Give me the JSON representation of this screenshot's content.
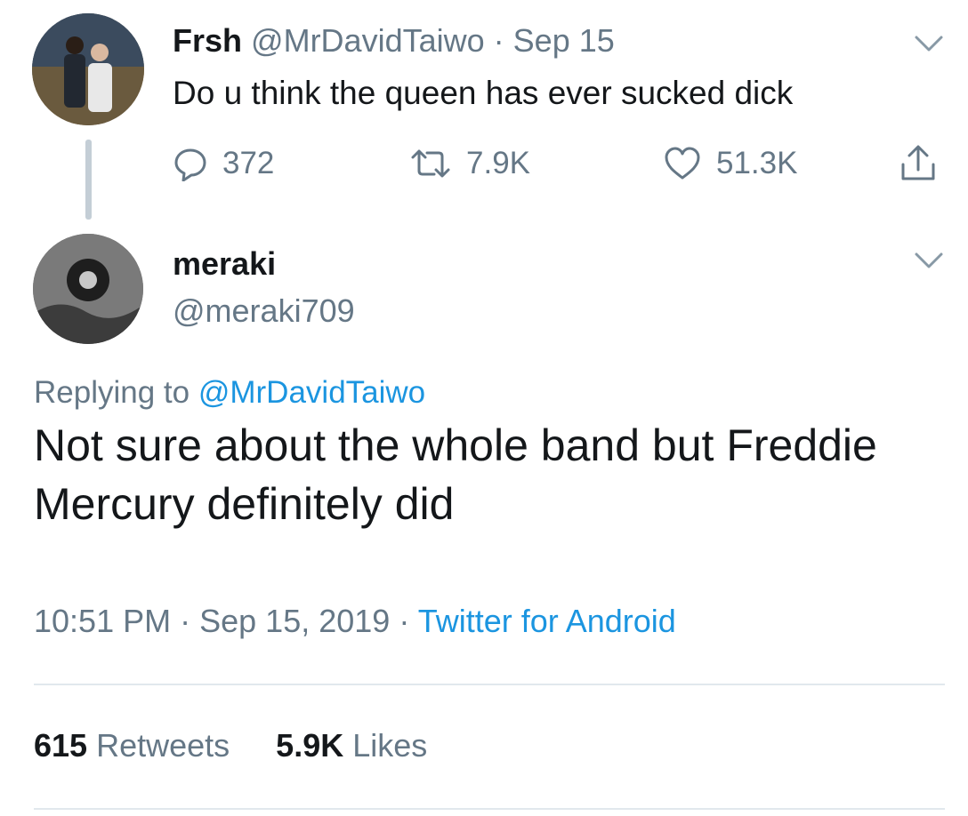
{
  "parent_tweet": {
    "display_name": "Frsh",
    "handle": "@MrDavidTaiwo",
    "separator": "·",
    "date": "Sep 15",
    "text": "Do u think the queen has ever sucked dick",
    "replies": "372",
    "retweets": "7.9K",
    "likes": "51.3K",
    "icons": {
      "reply": "reply-icon",
      "retweet": "retweet-icon",
      "like": "heart-icon",
      "share": "share-icon",
      "menu": "chevron-down-icon"
    }
  },
  "reply_tweet": {
    "display_name": "meraki",
    "handle": "@meraki709",
    "replying_prefix": "Replying to",
    "replying_to": "@MrDavidTaiwo",
    "text": "Not sure about the whole band but Freddie Mercury definitely did",
    "time": "10:51 PM",
    "date": "Sep 15, 2019",
    "separator": "·",
    "source": "Twitter for Android",
    "retweet_count": "615",
    "retweet_label": "Retweets",
    "like_count": "5.9K",
    "like_label": "Likes"
  },
  "colors": {
    "text_primary": "#14171a",
    "text_secondary": "#657786",
    "link": "#1b95e0",
    "divider": "#e1e8ed",
    "thread_line": "#c4ced6"
  }
}
